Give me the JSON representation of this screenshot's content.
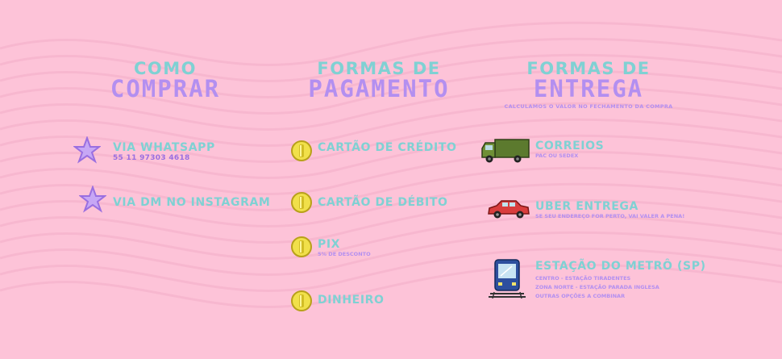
{
  "como_comprar": {
    "title_top": "COMO",
    "title_bottom": "COMPRAR",
    "items": [
      {
        "label": "VIA WHATSAPP",
        "detail": "55 11 97303 4618",
        "icon": "star-icon"
      },
      {
        "label": "VIA DM NO INSTAGRAM",
        "icon": "star-icon"
      }
    ]
  },
  "pagamento": {
    "title_top": "FORMAS DE",
    "title_bottom": "PAGAMENTO",
    "items": [
      {
        "label": "CARTÃO DE CRÉDITO",
        "icon": "coin-icon"
      },
      {
        "label": "CARTÃO DE DÉBITO",
        "icon": "coin-icon"
      },
      {
        "label": "PIX",
        "detail": "5% DE DESCONTO",
        "icon": "coin-icon"
      },
      {
        "label": "DINHEIRO",
        "icon": "coin-icon"
      }
    ]
  },
  "entrega": {
    "title_top": "FORMAS DE",
    "title_bottom": "ENTREGA",
    "subtitle": "CALCULAMOS O VALOR NO FECHAMENTO DA COMPRA",
    "items": [
      {
        "label": "CORREIOS",
        "detail": "PAC OU SEDEX",
        "icon": "truck-icon"
      },
      {
        "label": "UBER ENTREGA",
        "detail": "SE SEU ENDEREÇO FOR PERTO, VAI VALER A PENA!",
        "icon": "car-icon"
      },
      {
        "label": "ESTAÇÃO DO METRÔ (SP)",
        "details": [
          "CENTRO - ESTAÇÃO TIRADENTES",
          "ZONA NORTE - ESTAÇÃO PARADA INGLESA",
          "OUTRAS OPÇÕES A COMBINAR"
        ],
        "icon": "metro-train-icon"
      }
    ]
  },
  "colors": {
    "background": "#fdc3d8",
    "title_teal": "#7fd1d3",
    "title_purple": "#b38ff0"
  }
}
